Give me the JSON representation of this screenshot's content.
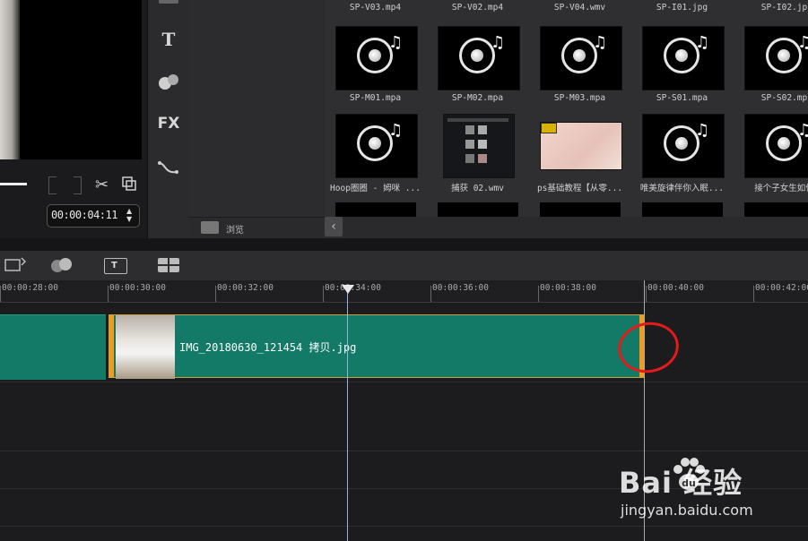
{
  "preview": {
    "timecode": "00:00:04:11"
  },
  "toolstrip": {
    "title_tool": "T",
    "fx_tool": "FX"
  },
  "gallery": {
    "browse_label": "浏览",
    "top_row": [
      "SP-V03.mp4",
      "SP-V02.mp4",
      "SP-V04.wmv",
      "SP-I01.jpg",
      "SP-I02.jp"
    ],
    "row1": [
      "SP-M01.mpa",
      "SP-M02.mpa",
      "SP-M03.mpa",
      "SP-S01.mpa",
      "SP-S02.mp"
    ],
    "row2": [
      "Hoop圈圈 - 姆咪 ...",
      "捕获 02.wmv",
      "ps基础教程【从零...",
      "唯美旋律伴你入眠...",
      "接个子女生如何"
    ]
  },
  "timeline": {
    "ruler": [
      "00:00:28:00",
      "00:00:30:00",
      "00:00:32:00",
      "00:00:34:00",
      "00:00:36:00",
      "00:00:38:00",
      "00:00:40:00",
      "00:00:42:00"
    ],
    "clip_label": "IMG_20180630_121454 拷贝.jpg"
  },
  "watermark": {
    "brand": "Bai  经验",
    "brand_du": "du",
    "url": "jingyan.baidu.com"
  },
  "colors": {
    "clip_green": "#127a66",
    "clip_edge": "#f29b20",
    "annotation_red": "#e21b1b"
  }
}
